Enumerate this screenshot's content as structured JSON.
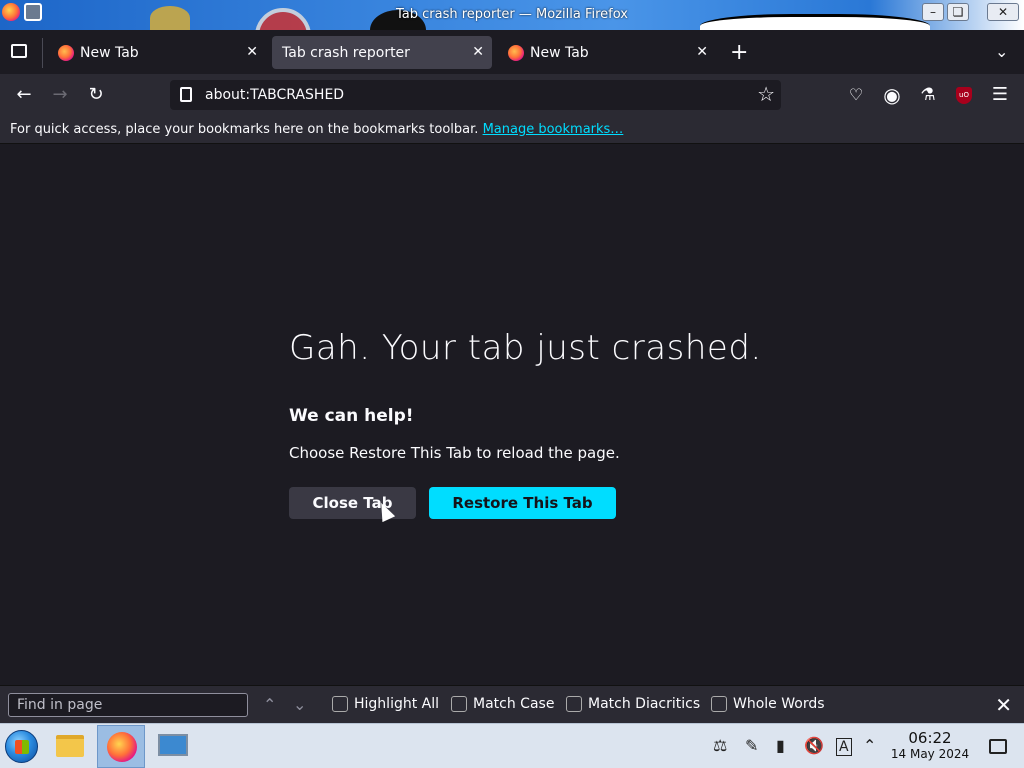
{
  "window": {
    "title": "Tab crash reporter — Mozilla Firefox",
    "controls": [
      "minimize",
      "maximize",
      "close"
    ]
  },
  "tabs": [
    {
      "label": "New Tab",
      "active": false
    },
    {
      "label": "Tab crash reporter",
      "active": true
    },
    {
      "label": "New Tab",
      "active": false
    }
  ],
  "toolbar": {
    "url": "about:TABCRASHED",
    "new_tab_symbol": "+"
  },
  "bookmarks": {
    "message": "For quick access, place your bookmarks here on the bookmarks toolbar.",
    "link": "Manage bookmarks…"
  },
  "crash": {
    "title": "Gah. Your tab just crashed.",
    "subtitle": "We can help!",
    "description": "Choose Restore This Tab to reload the page.",
    "close_button": "Close Tab",
    "restore_button": "Restore This Tab"
  },
  "findbar": {
    "placeholder": "Find in page",
    "options": [
      {
        "label": "Highlight All",
        "checked": false
      },
      {
        "label": "Match Case",
        "checked": false
      },
      {
        "label": "Match Diacritics",
        "checked": false
      },
      {
        "label": "Whole Words",
        "checked": false
      }
    ]
  },
  "taskbar": {
    "time": "06:22",
    "date": "14 May 2024"
  },
  "colors": {
    "accent": "#00ddff",
    "background": "#1c1b22",
    "toolbar": "#2b2a33"
  }
}
